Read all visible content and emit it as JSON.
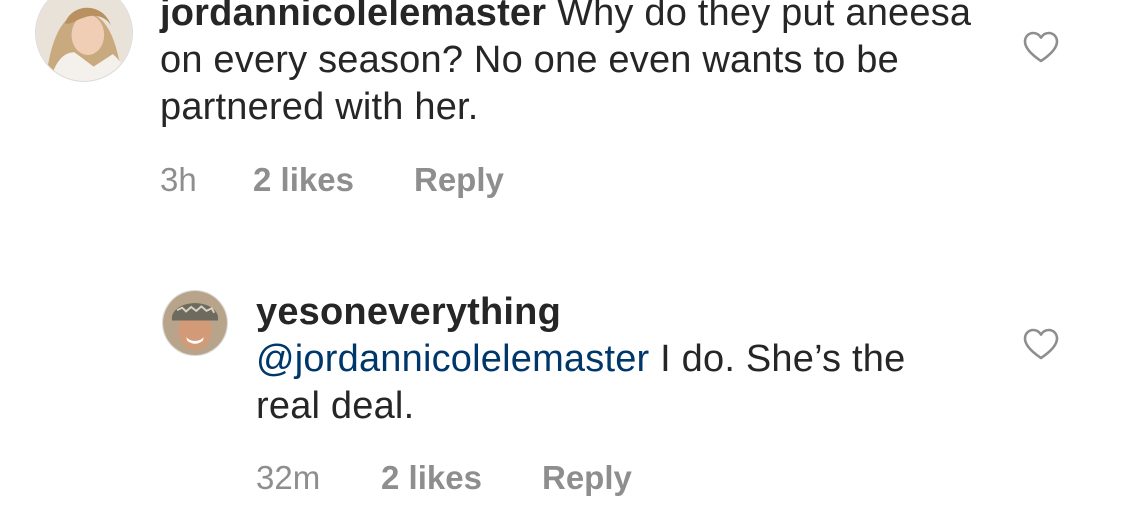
{
  "comments": [
    {
      "username": "jordannicolelemaster",
      "mention": "",
      "text": "Why do they put aneesa on every season? No one even wants to be partnered with her.",
      "time": "3h",
      "likes": "2 likes",
      "reply_label": "Reply",
      "liked": false
    },
    {
      "username": "yesoneverything",
      "mention": "@jordannicolelemaster",
      "text": "I do. She’s the real deal.",
      "time": "32m",
      "likes": "2 likes",
      "reply_label": "Reply",
      "liked": false
    }
  ],
  "icons": {
    "like": "heart-outline-icon"
  },
  "colors": {
    "text": "#262626",
    "meta": "#8e8e8e",
    "mention": "#00376b",
    "heart_stroke": "#8e8e8e"
  }
}
